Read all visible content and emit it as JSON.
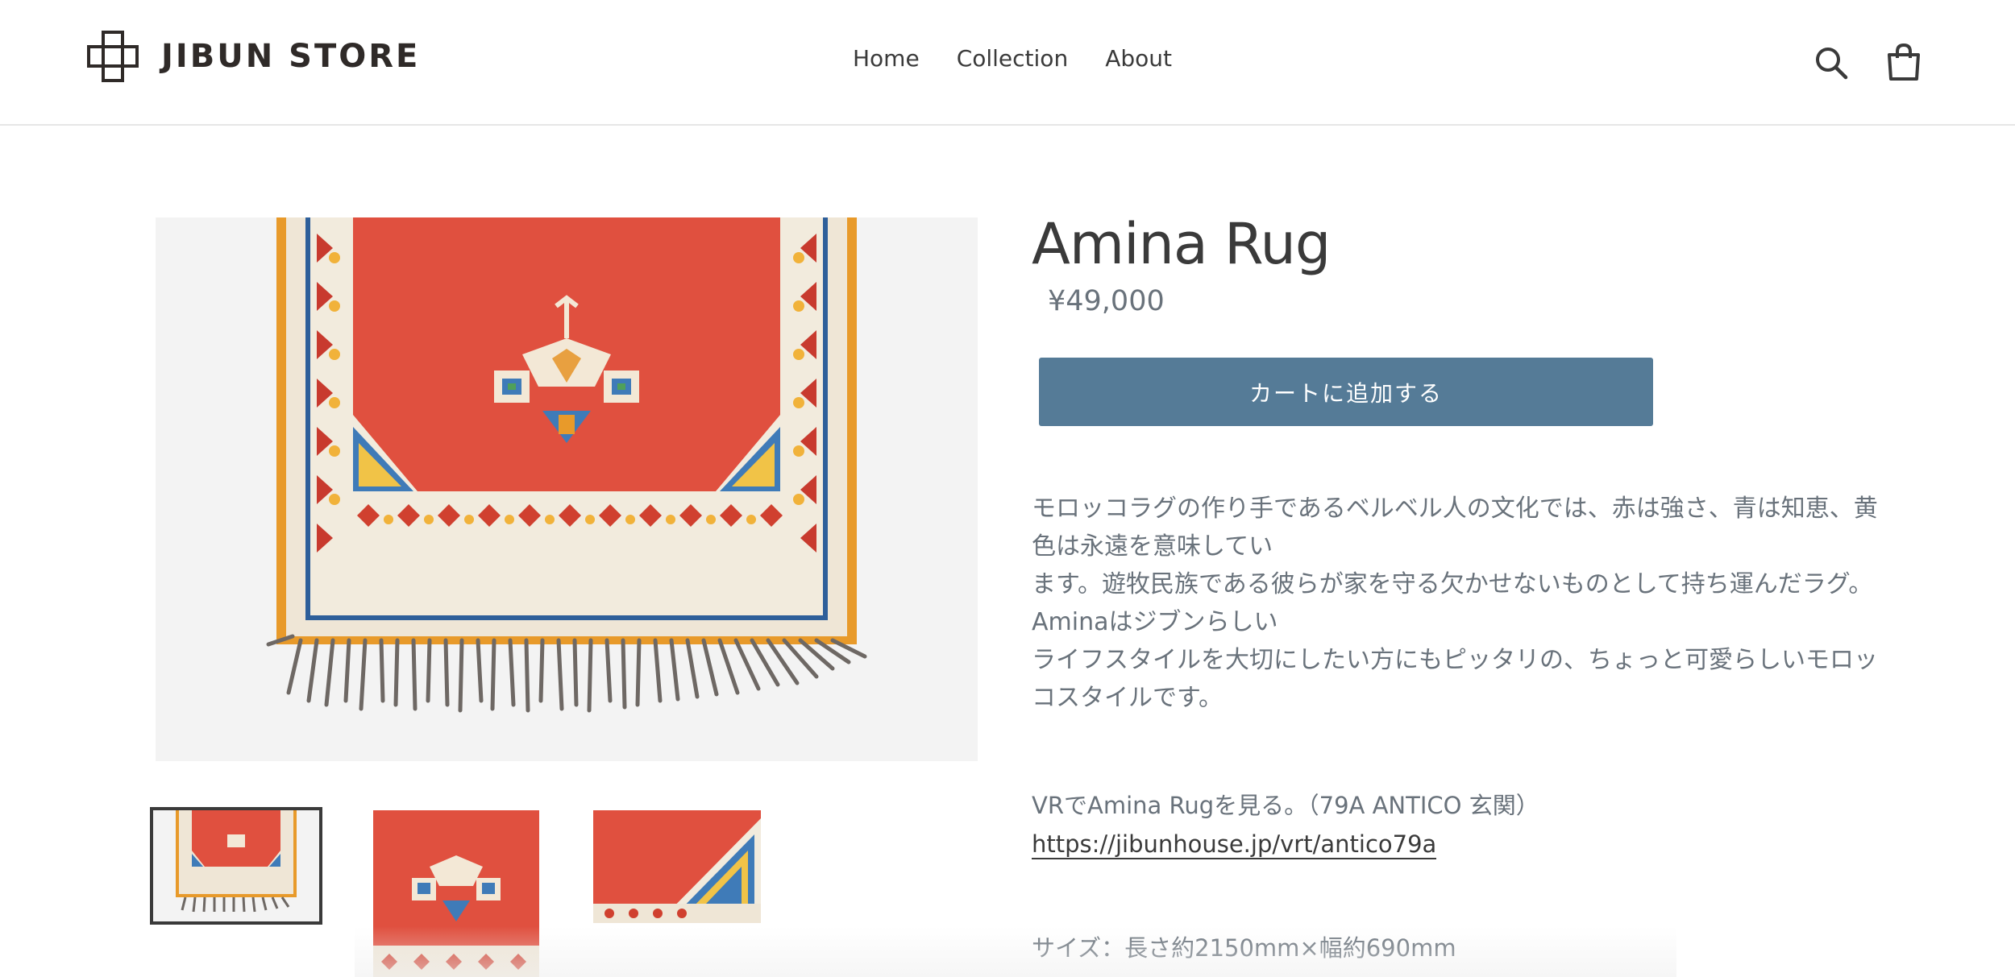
{
  "store": {
    "name": "JIBUN STORE"
  },
  "nav": {
    "items": [
      "Home",
      "Collection",
      "About"
    ]
  },
  "header": {
    "search_icon": "search-icon",
    "cart_icon": "bag-icon"
  },
  "product": {
    "title": "Amina Rug",
    "price": "¥49,000",
    "add_to_cart_label": "カートに追加する",
    "description": [
      "モロッコラグの作り手であるベルベル人の文化では、赤は強さ、青は知恵、黄色は永遠を意味してい",
      "ます。遊牧民族である彼らが家を守る欠かせないものとして持ち運んだラグ。Aminaはジブンらしい",
      "ライフスタイルを大切にしたい方にもピッタリの、ちょっと可愛らしいモロッコスタイルです。"
    ],
    "vr_text": "VRでAmina Rugを見る。（79A ANTICO 玄関）",
    "vr_link": "https://jibunhouse.jp/vrt/antico79a",
    "size_text": "サイズ：長さ約2150mm×幅約690mm"
  },
  "colors": {
    "accent": "#557b97",
    "text": "#3a3a3a",
    "muted": "#69727b",
    "rug_red": "#e0503f",
    "rug_border": "#f0a830"
  }
}
